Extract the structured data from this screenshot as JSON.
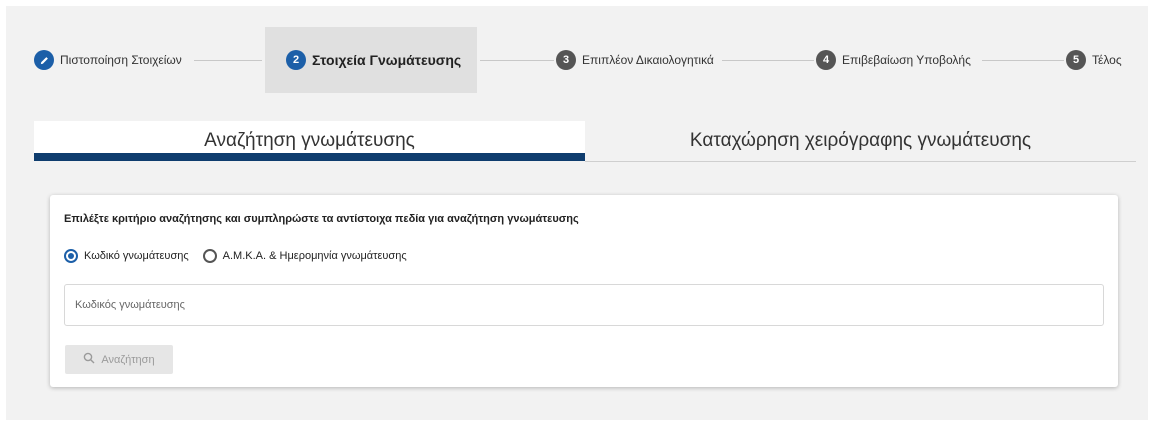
{
  "stepper": {
    "steps": [
      {
        "number": "1",
        "label": "Πιστοποίηση Στοιχείων",
        "state": "done",
        "icon": "pencil-icon"
      },
      {
        "number": "2",
        "label": "Στοιχεία Γνωμάτευσης",
        "state": "active"
      },
      {
        "number": "3",
        "label": "Επιπλέον Δικαιολογητικά",
        "state": "pending"
      },
      {
        "number": "4",
        "label": "Επιβεβαίωση Υποβολής",
        "state": "pending"
      },
      {
        "number": "5",
        "label": "Τέλος",
        "state": "pending"
      }
    ]
  },
  "tabs": {
    "search": "Αναζήτηση γνωμάτευσης",
    "manual": "Καταχώρηση χειρόγραφης γνωμάτευσης"
  },
  "card": {
    "title": "Επιλέξτε κριτήριο αναζήτησης και συμπληρώστε τα αντίστοιχα πεδία για αναζήτηση γνωμάτευσης",
    "radio_code": "Κωδικό γνωμάτευσης",
    "radio_amka": "Α.Μ.Κ.Α. & Ημερομηνία γνωμάτευσης",
    "selected": "code",
    "input_placeholder": "Κωδικός γνωμάτευσης",
    "search_button": "Αναζήτηση"
  },
  "colors": {
    "accent": "#1c5fa8",
    "tab_bar": "#0f3d6e"
  }
}
